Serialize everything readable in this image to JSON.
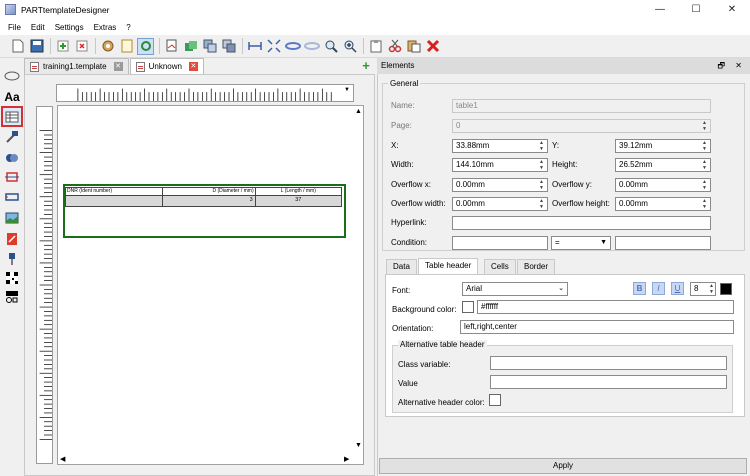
{
  "window": {
    "title": "PARTtemplateDesigner",
    "minimize": "—",
    "maximize": "☐",
    "close": "✕"
  },
  "menu": [
    "File",
    "Edit",
    "Settings",
    "Extras",
    "?"
  ],
  "toolbar_icons": [
    "new-document-icon",
    "save-icon",
    "add-icon",
    "delete-icon",
    "settings-icon",
    "page-icon",
    "refresh-icon",
    "print-preview-icon",
    "export-icon",
    "layers-icon",
    "copy-layer-icon",
    "stretch-horizontal-icon",
    "fit-icon",
    "link-icon",
    "unlink-icon",
    "zoom-out-icon",
    "zoom-in-icon",
    "clipboard-icon",
    "cut-icon",
    "paste-icon",
    "remove-icon"
  ],
  "left_tools": [
    "ellipse-icon",
    "text-tool-icon",
    "table-tool-icon",
    "hammer-icon",
    "boolean-icon",
    "measure-icon",
    "ruler-icon",
    "image-icon",
    "pdf-icon",
    "pin-icon",
    "qr-code-icon",
    "barcode-icon"
  ],
  "doc_tabs": [
    {
      "label": "training1.template",
      "active": false
    },
    {
      "label": "Unknown",
      "active": true
    }
  ],
  "table": {
    "headers": [
      "DNR (Ident number)",
      "D (Diameter / mm)",
      "L (Length / mm)"
    ],
    "row": [
      "",
      "3",
      "37"
    ]
  },
  "panel": {
    "title": "Elements",
    "controls": "🗗 ✕",
    "general_title": "General",
    "name_label": "Name:",
    "name_value": "table1",
    "page_label": "Page:",
    "page_value": "0",
    "x_label": "X:",
    "x_value": "33.88mm",
    "y_label": "Y:",
    "y_value": "39.12mm",
    "width_label": "Width:",
    "width_value": "144.10mm",
    "height_label": "Height:",
    "height_value": "26.52mm",
    "overflow_x_label": "Overflow x:",
    "overflow_x_value": "0.00mm",
    "overflow_y_label": "Overflow y:",
    "overflow_y_value": "0.00mm",
    "overflow_width_label": "Overflow width:",
    "overflow_width_value": "0.00mm",
    "overflow_height_label": "Overflow height:",
    "overflow_height_value": "0.00mm",
    "hyperlink_label": "Hyperlink:",
    "hyperlink_value": "",
    "condition_label": "Condition:",
    "condition_left": "",
    "condition_op": "=",
    "condition_right": ""
  },
  "prop_tabs": [
    {
      "label": "Data",
      "active": false
    },
    {
      "label": "Table header",
      "active": true
    },
    {
      "label": "Cells",
      "active": false
    },
    {
      "label": "Border",
      "active": false
    }
  ],
  "header_tab": {
    "font_label": "Font:",
    "font_value": "Arial",
    "bold": "B",
    "italic": "I",
    "underline": "U",
    "font_size": "8",
    "bg_label": "Background color:",
    "bg_value": "#ffffff",
    "orientation_label": "Orientation:",
    "orientation_value": "left,right,center",
    "alt_title": "Alternative table header",
    "class_var_label": "Class variable:",
    "class_var_value": "",
    "value_label": "Value",
    "value_value": "",
    "alt_color_label": "Alternative header color:"
  },
  "apply_label": "Apply",
  "colors": {
    "selection_frame": "#1a6e1a",
    "active_tool_outline": "#d23232",
    "font_color": "#000000",
    "header_bg": "#ffffff"
  }
}
